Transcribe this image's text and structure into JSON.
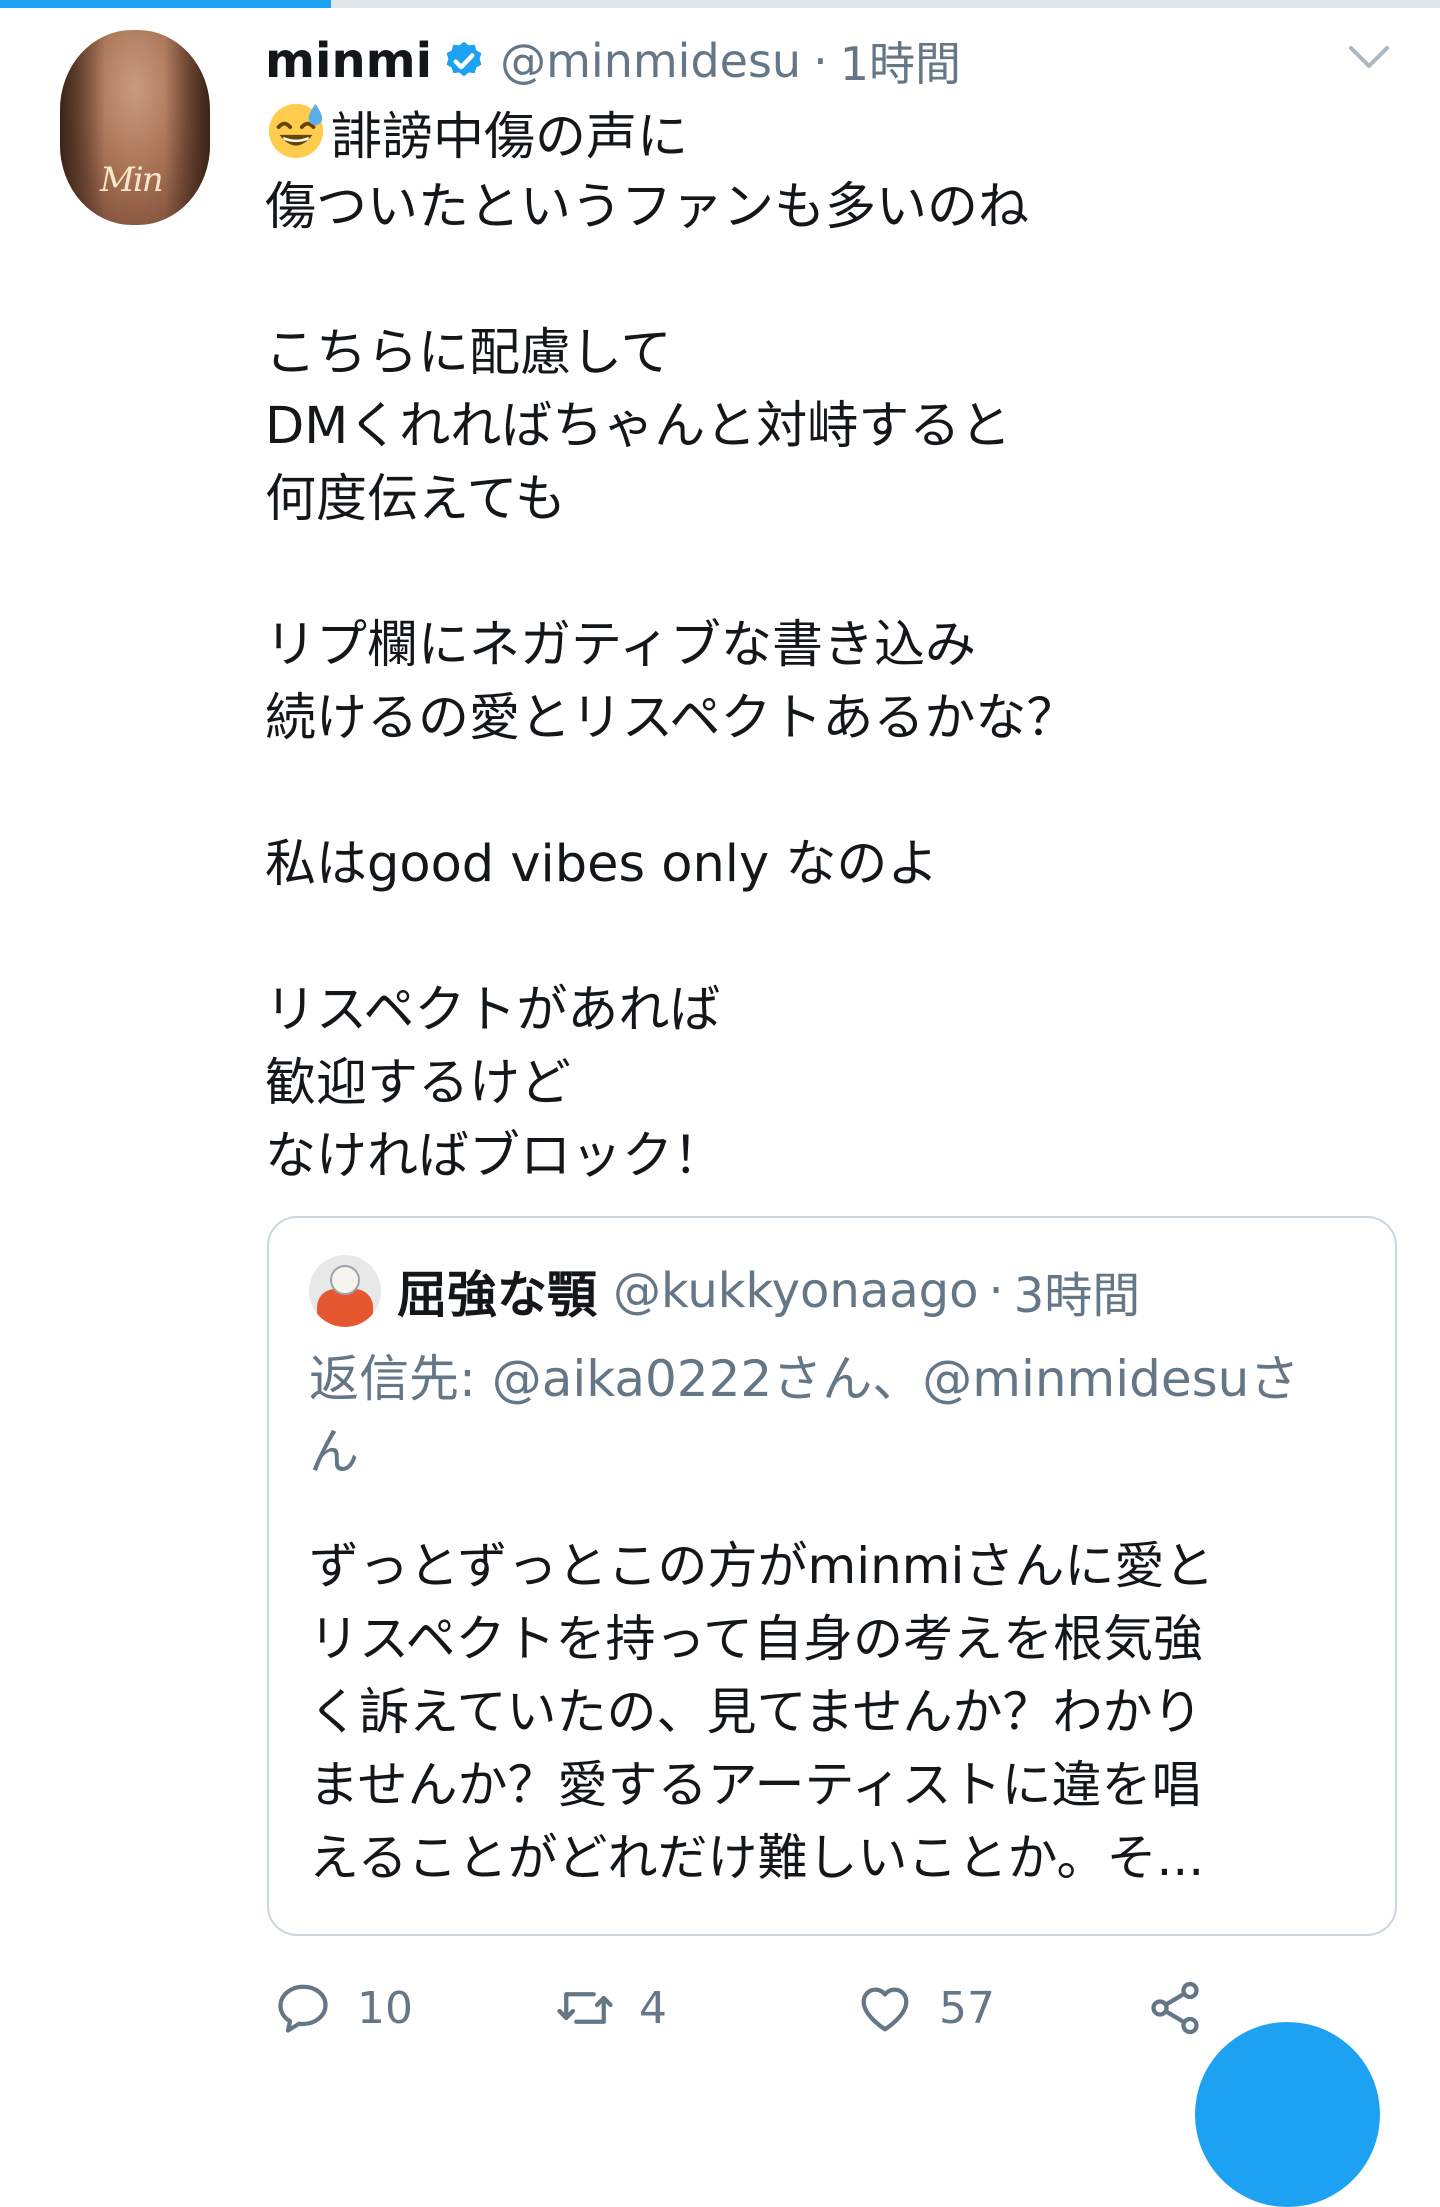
{
  "progress": {
    "fraction": 0.23,
    "accent": "#1da1f2",
    "track": "#e1e8ed"
  },
  "tweet": {
    "author_name": "minmi",
    "verified": true,
    "handle": "@minmidesu",
    "separator": "·",
    "time": "1時間",
    "avatar_signature": "Min",
    "emoji": "sweat-smile-emoji",
    "lines": [
      "誹謗中傷の声に",
      "傷ついたというファンも多いのね",
      "",
      "こちらに配慮して",
      "DMくれればちゃんと対峙すると",
      "何度伝えても",
      "",
      "リプ欄にネガティブな書き込み",
      "続けるの愛とリスペクトあるかな？",
      "",
      "私はgood vibes only なのよ",
      "",
      "リスペクトがあれば",
      "歓迎するけど",
      "なければブロック！"
    ]
  },
  "quote": {
    "author_name": "屈強な顎",
    "handle": "@kukkyonaago",
    "separator": "·",
    "time": "3時間",
    "reply_lines": [
      "返信先: @aika0222さん、@minmidesuさ",
      "ん"
    ],
    "text_lines": [
      "ずっとずっとこの方がminmiさんに愛と",
      "リスペクトを持って自身の考えを根気強",
      "く訴えていたの、見てませんか？わかり",
      "ませんか？愛するアーティストに違を唱",
      "えることがどれだけ難しいことか。そ..."
    ]
  },
  "actions": {
    "reply_count": "10",
    "retweet_count": "4",
    "like_count": "57",
    "icon_color": "#657786"
  },
  "colors": {
    "text": "#14171a",
    "secondary": "#657786",
    "border": "#ccd6dd",
    "brand": "#1da1f2"
  }
}
